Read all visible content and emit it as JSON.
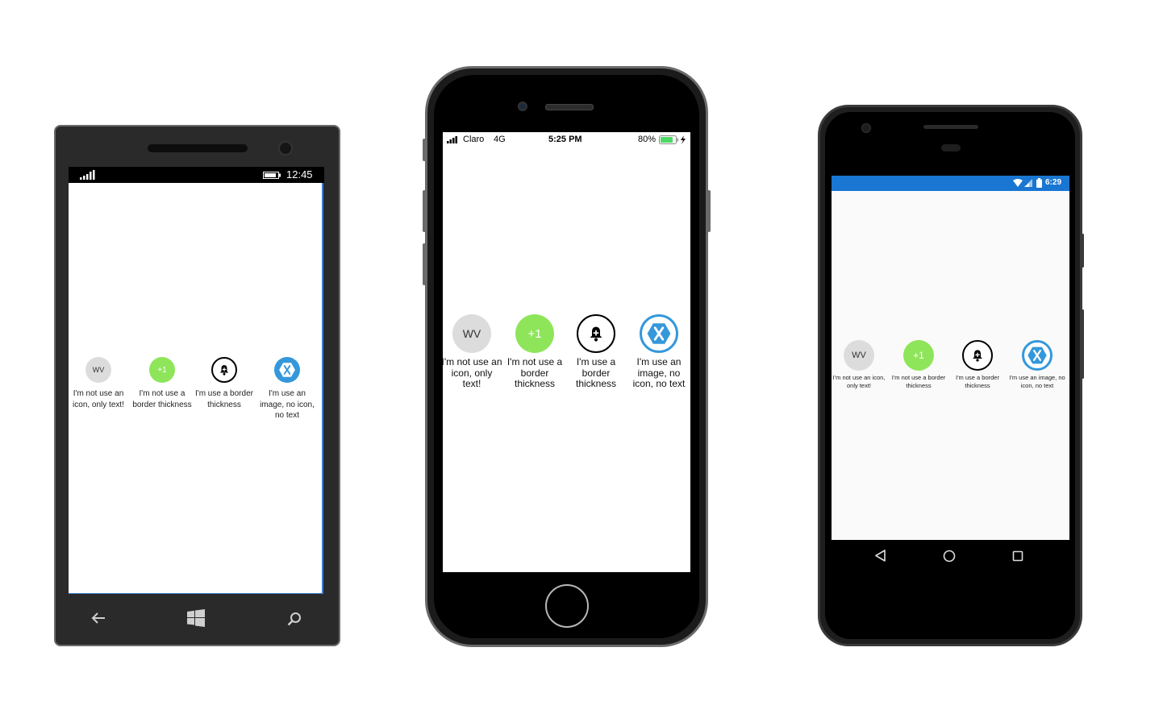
{
  "colors": {
    "accent_green": "#8ee55a",
    "xamarin_blue": "#3498db",
    "avatar_gray": "#dcdcdc",
    "android_status": "#1976d2"
  },
  "avatars": [
    {
      "text": "WV",
      "label": "I'm not use an icon, only text!"
    },
    {
      "text": "+1",
      "label": "I'm not use a border thickness"
    },
    {
      "icon": "bell-plus-icon",
      "label": "I'm use a border thickness"
    },
    {
      "icon": "xamarin-logo-icon",
      "label": "I'm use an image, no icon, no text"
    }
  ],
  "windows": {
    "status": {
      "time": "12:45"
    }
  },
  "ios": {
    "status": {
      "carrier": "Claro",
      "network": "4G",
      "time": "5:25 PM",
      "battery": "80%"
    }
  },
  "android": {
    "status": {
      "time": "6:29"
    }
  }
}
